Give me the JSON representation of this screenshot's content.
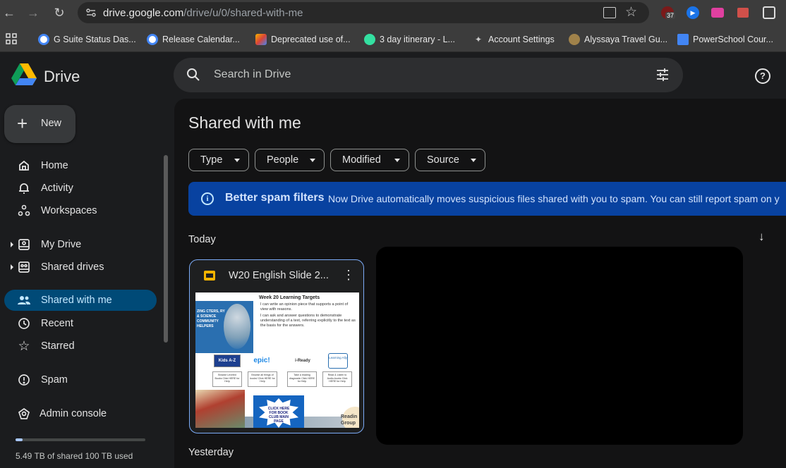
{
  "browser": {
    "url_host": "drive.google.com",
    "url_path": "/drive/u/0/shared-with-me",
    "extension_badge": "37"
  },
  "bookmarks": [
    {
      "label": "G Suite Status Das...",
      "icon": "google-icon"
    },
    {
      "label": "Release Calendar...",
      "icon": "google-icon"
    },
    {
      "label": "Deprecated use of...",
      "icon": "stack-icon"
    },
    {
      "label": "3 day itinerary - L...",
      "icon": "tripadvisor-icon"
    },
    {
      "label": "Account Settings",
      "icon": "sparkle-icon"
    },
    {
      "label": "Alyssaya Travel Gu...",
      "icon": "lotus-icon"
    },
    {
      "label": "PowerSchool Cour...",
      "icon": "docs-icon"
    }
  ],
  "app": {
    "name": "Drive",
    "new_label": "New",
    "search_placeholder": "Search in Drive"
  },
  "nav": [
    {
      "label": "Home",
      "icon": "home-icon"
    },
    {
      "label": "Activity",
      "icon": "bell-icon"
    },
    {
      "label": "Workspaces",
      "icon": "workspaces-icon"
    },
    {
      "label": "My Drive",
      "icon": "my-drive-icon"
    },
    {
      "label": "Shared drives",
      "icon": "shared-drives-icon"
    },
    {
      "label": "Shared with me",
      "icon": "people-icon"
    },
    {
      "label": "Recent",
      "icon": "clock-icon"
    },
    {
      "label": "Starred",
      "icon": "star-icon"
    },
    {
      "label": "Spam",
      "icon": "spam-icon"
    },
    {
      "label": "Admin console",
      "icon": "admin-icon"
    }
  ],
  "storage": {
    "text": "5.49 TB of shared 100 TB used",
    "used_fraction": 0.055
  },
  "page": {
    "title": "Shared with me",
    "filters": [
      "Type",
      "People",
      "Modified",
      "Source"
    ],
    "banner_title": "Better spam filters",
    "banner_text": "Now Drive automatically moves suspicious files shared with you to spam. You can still report spam on y",
    "section_today": "Today",
    "section_yesterday": "Yesterday"
  },
  "file": {
    "name": "W20 English Slide 2...",
    "thumb": {
      "heading": "Week 20 Learning Targets",
      "bullets": [
        "I can write an opinion piece that supports a point of view with reasons.",
        "I can ask and answer questions to demonstrate understanding of a text, referring explicitly to the text as the basis for the answers."
      ],
      "left_words": "ZING CTERS, RY & SCIENCE COMMUNITY HELPERS",
      "apps": [
        "Kids A-Z",
        "epic!",
        "i-Ready",
        "Learning Ally"
      ],
      "app_captions": [
        "Browse Leveled Books Click HERE for Help",
        "Browse all things of books! Click HERE for Help",
        "Take a reading diagnostic Click HERE for Help",
        "Read & Listen to Audio-books Click HERE for Help"
      ],
      "burst_text": "CLICK HERE FOR BOOK CLUB MAIN PAGE",
      "corner_text": "Readin Group"
    }
  },
  "colors": {
    "active_nav_bg": "#004a77",
    "banner_bg": "#0842a0",
    "card_border": "#7cacf8"
  }
}
